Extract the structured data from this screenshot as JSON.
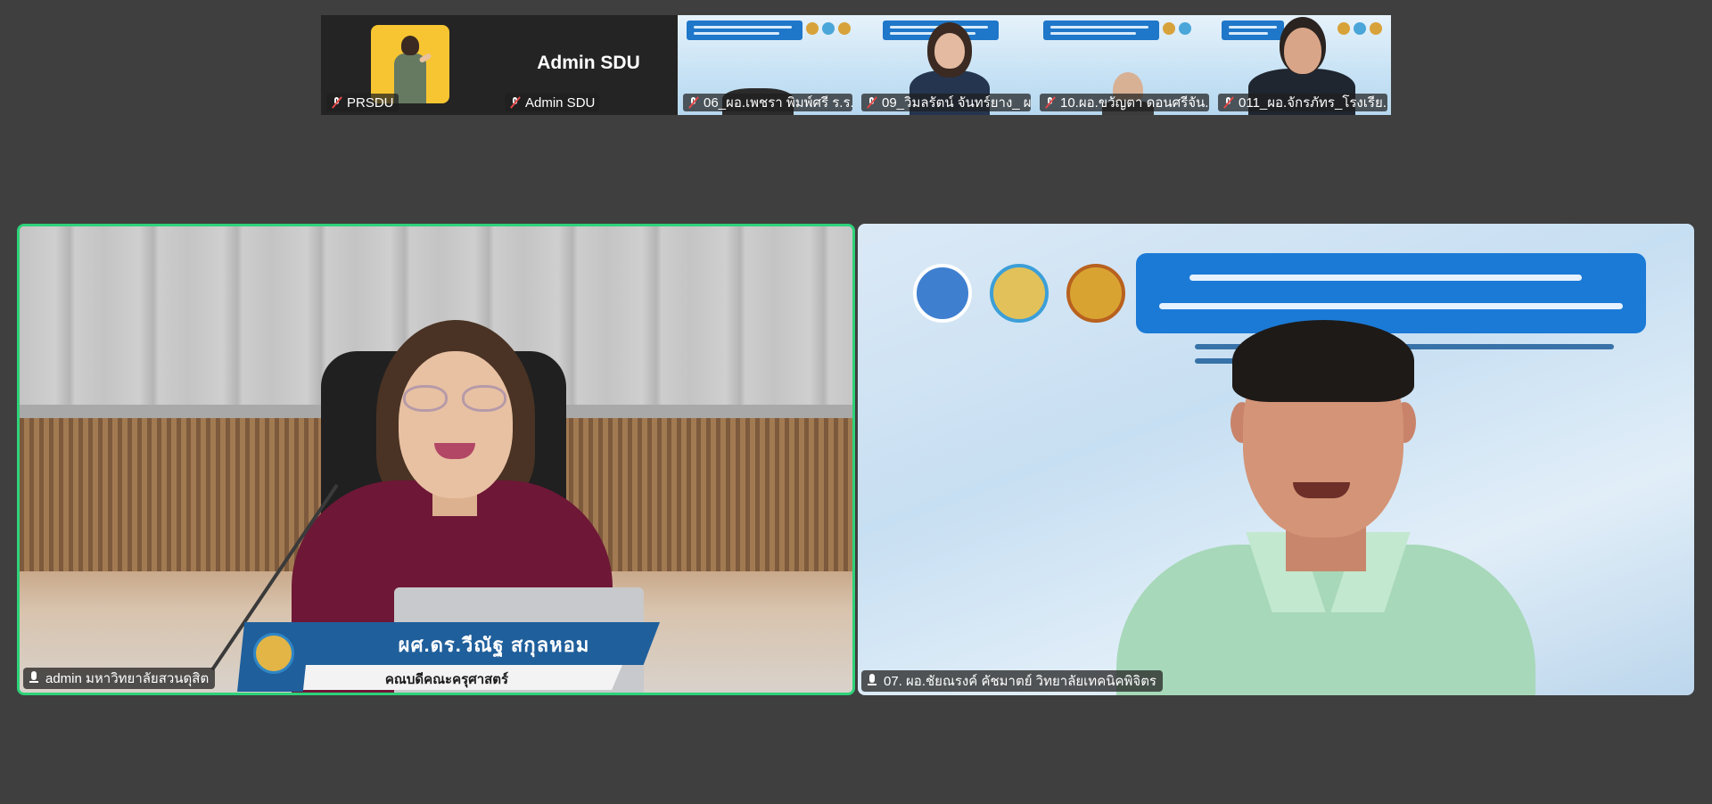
{
  "thumbnails": [
    {
      "name": "PRSDU",
      "muted": true,
      "type": "avatar"
    },
    {
      "name": "Admin SDU",
      "display_name": "Admin SDU",
      "muted": true,
      "type": "name-only"
    },
    {
      "name": "06_ผอ.เพชรา พิมพ์ศรี ร.ร...",
      "muted": true,
      "type": "video"
    },
    {
      "name": "09_วิมลรัตน์ จันทร์ยาง_ ผ...",
      "muted": true,
      "type": "video"
    },
    {
      "name": "10.ผอ.ขวัญตา ดอนศรีจัน...",
      "muted": true,
      "type": "video"
    },
    {
      "name": "011_ผอ.จักรภัทร_โรงเรีย...",
      "muted": true,
      "type": "video"
    }
  ],
  "main_tiles": [
    {
      "name": "admin มหาวิทยาลัยสวนดุสิต",
      "active_speaker": true,
      "lower_third": {
        "title": "ผศ.ดร.วีณัฐ  สกุลหอม",
        "subtitle": "คณบดีคณะครุศาสตร์"
      }
    },
    {
      "name": "07. ผอ.ชัยณรงค์ คัชมาตย์ วิทยาลัยเทคนิคพิจิตร",
      "active_speaker": false
    }
  ],
  "colors": {
    "background": "#3f3f3f",
    "active_border": "#2ed27a",
    "muted_icon": "#e34848"
  },
  "icons": [
    "mic-muted-icon",
    "mic-icon"
  ]
}
